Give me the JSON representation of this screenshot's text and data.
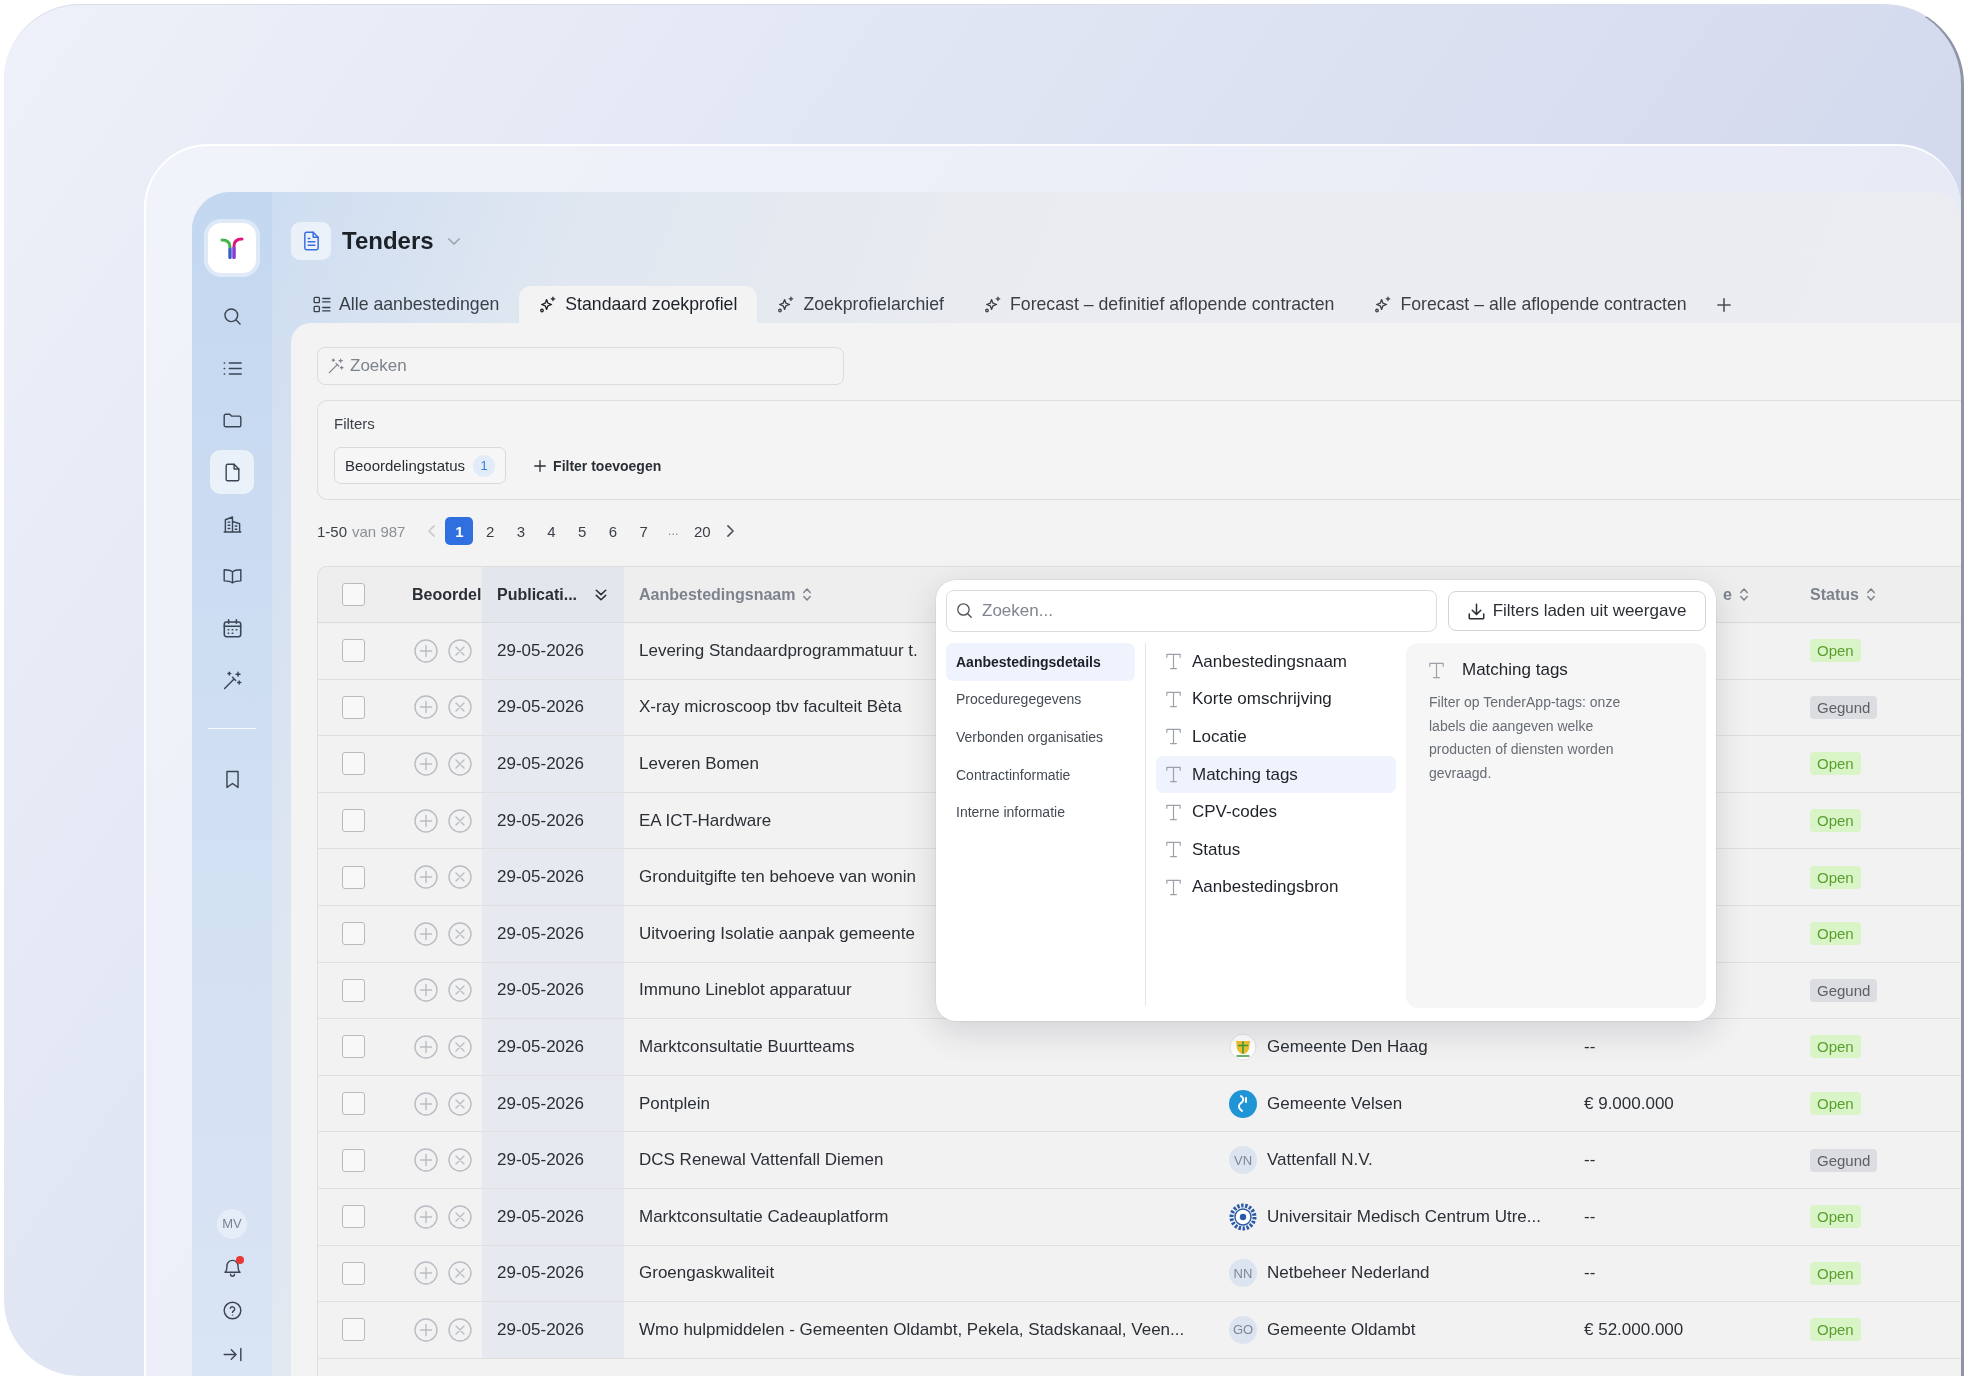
{
  "sidebar": {
    "items": [
      {
        "kind": "search",
        "selected": false
      },
      {
        "kind": "list",
        "selected": false
      },
      {
        "kind": "folder",
        "selected": false
      },
      {
        "kind": "document",
        "selected": true
      },
      {
        "kind": "building",
        "selected": false
      },
      {
        "kind": "book",
        "selected": false
      },
      {
        "kind": "calendar",
        "selected": false
      },
      {
        "kind": "wand",
        "selected": false
      }
    ],
    "lower_items": [
      {
        "kind": "bookmark",
        "selected": false
      }
    ],
    "avatar": "MV",
    "notifications": {
      "unread": true
    }
  },
  "header": {
    "title": "Tenders"
  },
  "tabs": [
    {
      "label": "Alle aanbestedingen",
      "kind": "list",
      "selected": false
    },
    {
      "label": "Standaard zoekprofiel",
      "kind": "profile",
      "selected": true
    },
    {
      "label": "Zoekprofielarchief",
      "kind": "profile",
      "selected": false
    },
    {
      "label": "Forecast – definitief aflopende contracten",
      "kind": "profile",
      "selected": false
    },
    {
      "label": "Forecast – alle aflopende contracten",
      "kind": "profile",
      "selected": false
    }
  ],
  "search": {
    "placeholder": "Zoeken"
  },
  "filters": {
    "title": "Filters",
    "chips": [
      {
        "label": "Beoordelingstatus",
        "count": "1"
      }
    ],
    "add_label": "Filter toevoegen"
  },
  "pagination": {
    "range": "1-50",
    "total": "van 987",
    "prev": {
      "disabled": true
    },
    "next": {
      "disabled": false
    },
    "pages": [
      {
        "label": "1",
        "kind": "page",
        "selected": true
      },
      {
        "label": "2",
        "kind": "page",
        "selected": false
      },
      {
        "label": "3",
        "kind": "page",
        "selected": false
      },
      {
        "label": "4",
        "kind": "page",
        "selected": false
      },
      {
        "label": "5",
        "kind": "page",
        "selected": false
      },
      {
        "label": "6",
        "kind": "page",
        "selected": false
      },
      {
        "label": "7",
        "kind": "page",
        "selected": false
      },
      {
        "label": "...",
        "kind": "ellipsis",
        "selected": false
      },
      {
        "label": "20",
        "kind": "page",
        "selected": false
      }
    ]
  },
  "table": {
    "select_all": {
      "checked": false
    },
    "columns": [
      {
        "kind": "review",
        "label": "Beoordel",
        "sortable": false
      },
      {
        "kind": "date",
        "label": "Publicati...",
        "sortable": true,
        "sorted": true
      },
      {
        "kind": "name",
        "label": "Aanbestedingsnaam",
        "sortable": true,
        "sorted": false
      },
      {
        "kind": "organisation"
      },
      {
        "kind": "amount",
        "label": "e",
        "sortable": true,
        "sorted": false
      },
      {
        "kind": "status",
        "label": "Status",
        "sortable": true,
        "sorted": false
      }
    ],
    "rows": [
      {
        "checked": false,
        "date": "29-05-2026",
        "name": "Levering Standaardprogrammatuur t.",
        "status": {
          "label": "Open",
          "color": "#5a9f2e"
        }
      },
      {
        "checked": false,
        "date": "29-05-2026",
        "name": "X-ray microscoop tbv faculteit Bèta",
        "status": {
          "label": "Gegund",
          "color": "#5c5f66"
        }
      },
      {
        "checked": false,
        "date": "29-05-2026",
        "name": "Leveren Bomen",
        "status": {
          "label": "Open",
          "color": "#5a9f2e"
        }
      },
      {
        "checked": false,
        "date": "29-05-2026",
        "name": "EA ICT-Hardware",
        "status": {
          "label": "Open",
          "color": "#5a9f2e"
        }
      },
      {
        "checked": false,
        "date": "29-05-2026",
        "name": "Gronduitgifte ten behoeve van wonin",
        "status": {
          "label": "Open",
          "color": "#5a9f2e"
        }
      },
      {
        "checked": false,
        "date": "29-05-2026",
        "name": "Uitvoering Isolatie aanpak gemeente",
        "status": {
          "label": "Open",
          "color": "#5a9f2e"
        }
      },
      {
        "checked": false,
        "date": "29-05-2026",
        "name": "Immuno Lineblot apparatuur",
        "status": {
          "label": "Gegund",
          "color": "#5c5f66"
        }
      },
      {
        "checked": false,
        "date": "29-05-2026",
        "name": "Marktconsultatie Buurtteams",
        "organisation": {
          "name": "Gemeente Den Haag",
          "logo": {
            "kind": "crest"
          }
        },
        "amount": "--",
        "status": {
          "label": "Open",
          "color": "#5a9f2e"
        }
      },
      {
        "checked": false,
        "date": "29-05-2026",
        "name": "Pontplein",
        "organisation": {
          "name": "Gemeente Velsen",
          "logo": {
            "kind": "disc"
          }
        },
        "amount": "€ 9.000.000",
        "status": {
          "label": "Open",
          "color": "#5a9f2e"
        }
      },
      {
        "checked": false,
        "date": "29-05-2026",
        "name": "DCS Renewal Vattenfall Diemen",
        "organisation": {
          "name": "Vattenfall N.V.",
          "logo": {
            "kind": "initials",
            "text": "VN"
          }
        },
        "amount": "--",
        "status": {
          "label": "Gegund",
          "color": "#5c5f66"
        }
      },
      {
        "checked": false,
        "date": "29-05-2026",
        "name": "Marktconsultatie Cadeauplatform",
        "organisation": {
          "name": "Universitair Medisch Centrum Utre...",
          "logo": {
            "kind": "cog"
          }
        },
        "amount": "--",
        "status": {
          "label": "Open",
          "color": "#5a9f2e"
        }
      },
      {
        "checked": false,
        "date": "29-05-2026",
        "name": "Groengaskwaliteit",
        "organisation": {
          "name": "Netbeheer Nederland",
          "logo": {
            "kind": "initials",
            "text": "NN"
          }
        },
        "amount": "--",
        "status": {
          "label": "Open",
          "color": "#5a9f2e"
        }
      },
      {
        "checked": false,
        "date": "29-05-2026",
        "name": "Wmo hulpmiddelen - Gemeenten Oldambt, Pekela, Stadskanaal, Veen...",
        "organisation": {
          "name": "Gemeente Oldambt",
          "logo": {
            "kind": "initials",
            "text": "GO"
          }
        },
        "amount": "€ 52.000.000",
        "status": {
          "label": "Open",
          "color": "#5a9f2e"
        }
      }
    ]
  },
  "filter_menu": {
    "search": {
      "placeholder": "Zoeken..."
    },
    "load_button": "Filters laden uit weergave",
    "categories": [
      {
        "label": "Aanbestedingsdetails",
        "selected": true
      },
      {
        "label": "Proceduregegevens",
        "selected": false
      },
      {
        "label": "Verbonden organisaties",
        "selected": false
      },
      {
        "label": "Contractinformatie",
        "selected": false
      },
      {
        "label": "Interne informatie",
        "selected": false
      }
    ],
    "fields": [
      {
        "label": "Aanbestedingsnaam",
        "selected": false
      },
      {
        "label": "Korte omschrijving",
        "selected": false
      },
      {
        "label": "Locatie",
        "selected": false
      },
      {
        "label": "Matching tags",
        "selected": true
      },
      {
        "label": "CPV-codes",
        "selected": false
      },
      {
        "label": "Status",
        "selected": false
      },
      {
        "label": "Aanbestedingsbron",
        "selected": false
      }
    ],
    "detail": {
      "title": "Matching tags",
      "description": "Filter op TenderApp-tags: onze labels die aangeven welke producten of diensten worden gevraagd."
    }
  }
}
